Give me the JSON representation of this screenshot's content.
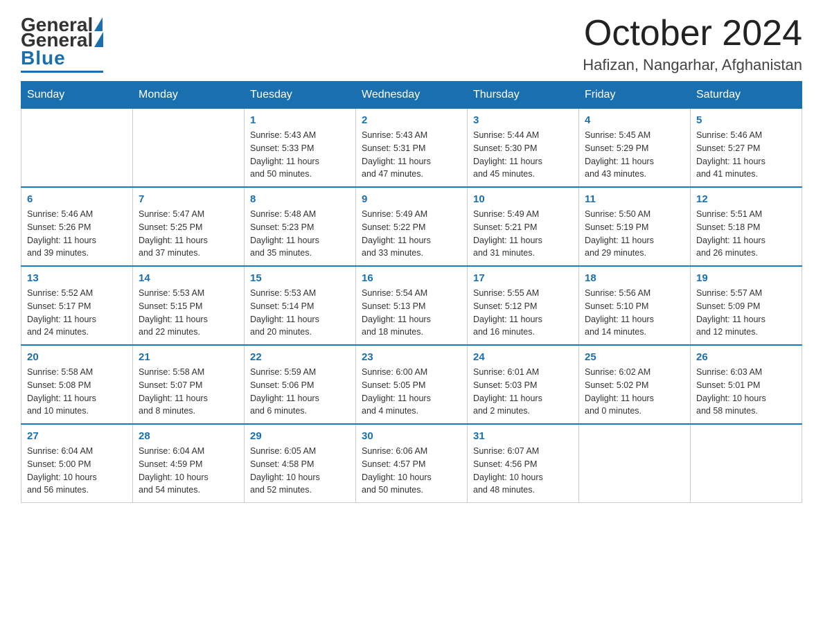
{
  "header": {
    "logo_general": "General",
    "logo_blue": "Blue",
    "month_title": "October 2024",
    "location": "Hafizan, Nangarhar, Afghanistan"
  },
  "days_of_week": [
    "Sunday",
    "Monday",
    "Tuesday",
    "Wednesday",
    "Thursday",
    "Friday",
    "Saturday"
  ],
  "weeks": [
    [
      {
        "day": "",
        "info": ""
      },
      {
        "day": "",
        "info": ""
      },
      {
        "day": "1",
        "info": "Sunrise: 5:43 AM\nSunset: 5:33 PM\nDaylight: 11 hours\nand 50 minutes."
      },
      {
        "day": "2",
        "info": "Sunrise: 5:43 AM\nSunset: 5:31 PM\nDaylight: 11 hours\nand 47 minutes."
      },
      {
        "day": "3",
        "info": "Sunrise: 5:44 AM\nSunset: 5:30 PM\nDaylight: 11 hours\nand 45 minutes."
      },
      {
        "day": "4",
        "info": "Sunrise: 5:45 AM\nSunset: 5:29 PM\nDaylight: 11 hours\nand 43 minutes."
      },
      {
        "day": "5",
        "info": "Sunrise: 5:46 AM\nSunset: 5:27 PM\nDaylight: 11 hours\nand 41 minutes."
      }
    ],
    [
      {
        "day": "6",
        "info": "Sunrise: 5:46 AM\nSunset: 5:26 PM\nDaylight: 11 hours\nand 39 minutes."
      },
      {
        "day": "7",
        "info": "Sunrise: 5:47 AM\nSunset: 5:25 PM\nDaylight: 11 hours\nand 37 minutes."
      },
      {
        "day": "8",
        "info": "Sunrise: 5:48 AM\nSunset: 5:23 PM\nDaylight: 11 hours\nand 35 minutes."
      },
      {
        "day": "9",
        "info": "Sunrise: 5:49 AM\nSunset: 5:22 PM\nDaylight: 11 hours\nand 33 minutes."
      },
      {
        "day": "10",
        "info": "Sunrise: 5:49 AM\nSunset: 5:21 PM\nDaylight: 11 hours\nand 31 minutes."
      },
      {
        "day": "11",
        "info": "Sunrise: 5:50 AM\nSunset: 5:19 PM\nDaylight: 11 hours\nand 29 minutes."
      },
      {
        "day": "12",
        "info": "Sunrise: 5:51 AM\nSunset: 5:18 PM\nDaylight: 11 hours\nand 26 minutes."
      }
    ],
    [
      {
        "day": "13",
        "info": "Sunrise: 5:52 AM\nSunset: 5:17 PM\nDaylight: 11 hours\nand 24 minutes."
      },
      {
        "day": "14",
        "info": "Sunrise: 5:53 AM\nSunset: 5:15 PM\nDaylight: 11 hours\nand 22 minutes."
      },
      {
        "day": "15",
        "info": "Sunrise: 5:53 AM\nSunset: 5:14 PM\nDaylight: 11 hours\nand 20 minutes."
      },
      {
        "day": "16",
        "info": "Sunrise: 5:54 AM\nSunset: 5:13 PM\nDaylight: 11 hours\nand 18 minutes."
      },
      {
        "day": "17",
        "info": "Sunrise: 5:55 AM\nSunset: 5:12 PM\nDaylight: 11 hours\nand 16 minutes."
      },
      {
        "day": "18",
        "info": "Sunrise: 5:56 AM\nSunset: 5:10 PM\nDaylight: 11 hours\nand 14 minutes."
      },
      {
        "day": "19",
        "info": "Sunrise: 5:57 AM\nSunset: 5:09 PM\nDaylight: 11 hours\nand 12 minutes."
      }
    ],
    [
      {
        "day": "20",
        "info": "Sunrise: 5:58 AM\nSunset: 5:08 PM\nDaylight: 11 hours\nand 10 minutes."
      },
      {
        "day": "21",
        "info": "Sunrise: 5:58 AM\nSunset: 5:07 PM\nDaylight: 11 hours\nand 8 minutes."
      },
      {
        "day": "22",
        "info": "Sunrise: 5:59 AM\nSunset: 5:06 PM\nDaylight: 11 hours\nand 6 minutes."
      },
      {
        "day": "23",
        "info": "Sunrise: 6:00 AM\nSunset: 5:05 PM\nDaylight: 11 hours\nand 4 minutes."
      },
      {
        "day": "24",
        "info": "Sunrise: 6:01 AM\nSunset: 5:03 PM\nDaylight: 11 hours\nand 2 minutes."
      },
      {
        "day": "25",
        "info": "Sunrise: 6:02 AM\nSunset: 5:02 PM\nDaylight: 11 hours\nand 0 minutes."
      },
      {
        "day": "26",
        "info": "Sunrise: 6:03 AM\nSunset: 5:01 PM\nDaylight: 10 hours\nand 58 minutes."
      }
    ],
    [
      {
        "day": "27",
        "info": "Sunrise: 6:04 AM\nSunset: 5:00 PM\nDaylight: 10 hours\nand 56 minutes."
      },
      {
        "day": "28",
        "info": "Sunrise: 6:04 AM\nSunset: 4:59 PM\nDaylight: 10 hours\nand 54 minutes."
      },
      {
        "day": "29",
        "info": "Sunrise: 6:05 AM\nSunset: 4:58 PM\nDaylight: 10 hours\nand 52 minutes."
      },
      {
        "day": "30",
        "info": "Sunrise: 6:06 AM\nSunset: 4:57 PM\nDaylight: 10 hours\nand 50 minutes."
      },
      {
        "day": "31",
        "info": "Sunrise: 6:07 AM\nSunset: 4:56 PM\nDaylight: 10 hours\nand 48 minutes."
      },
      {
        "day": "",
        "info": ""
      },
      {
        "day": "",
        "info": ""
      }
    ]
  ]
}
